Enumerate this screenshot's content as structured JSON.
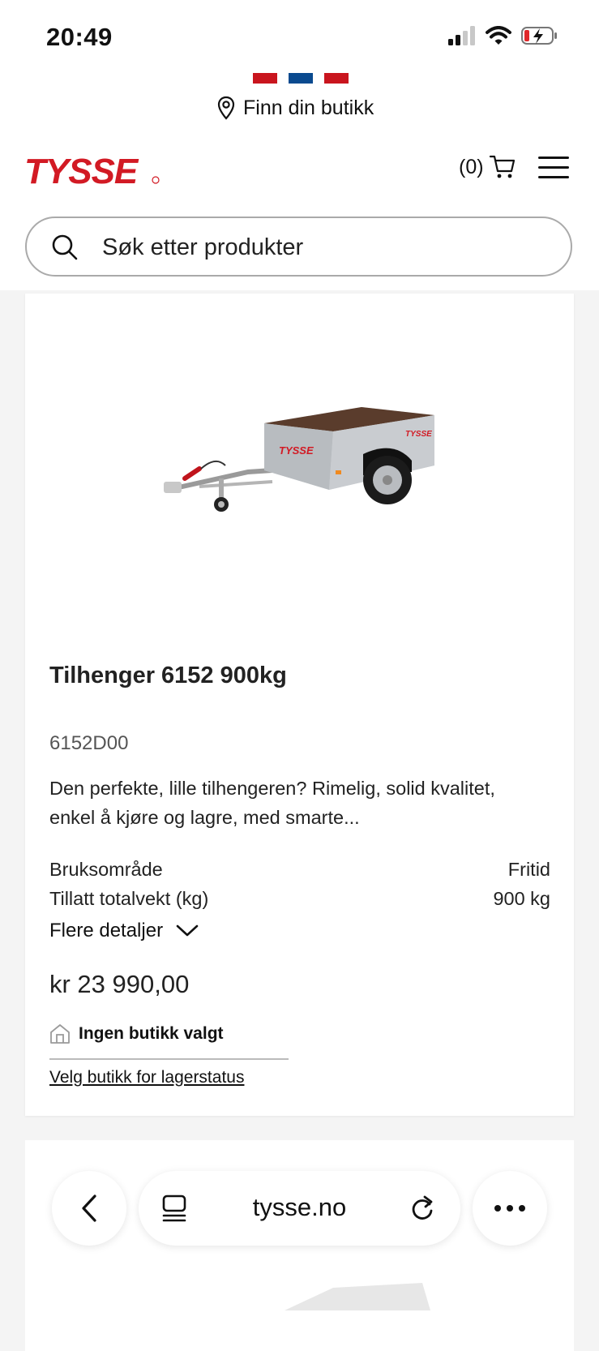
{
  "status_bar": {
    "time": "20:49"
  },
  "header": {
    "store_finder_label": "Finn din butikk",
    "logo_text": "TYSSE",
    "cart_count": "(0)",
    "brand_red": "#d21a24",
    "brand_blue": "#0a4a8f"
  },
  "search": {
    "placeholder": "Søk etter produkter"
  },
  "product": {
    "title": "Tilhenger 6152 900kg",
    "sku": "6152D00",
    "description": "Den perfekte, lille tilhengeren? Rimelig, solid kvalitet, enkel å kjøre og lagre, med smarte...",
    "specs": [
      {
        "label": "Bruksområde",
        "value": "Fritid"
      },
      {
        "label": "Tillatt totalvekt (kg)",
        "value": "900 kg"
      }
    ],
    "details_label": "Flere detaljer",
    "price": "kr 23 990,00",
    "store_status": "Ingen butikk valgt",
    "store_link": "Velg butikk for lagerstatus"
  },
  "browser": {
    "url": "tysse.no"
  }
}
